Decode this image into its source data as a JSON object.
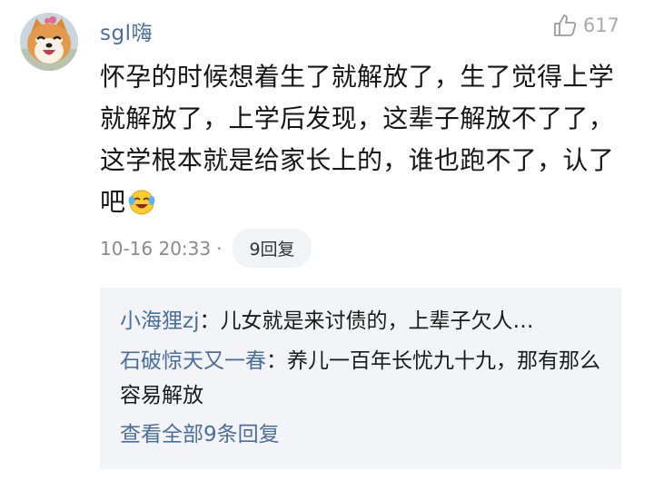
{
  "comment": {
    "username": "sgl嗨",
    "like_count": "617",
    "text": "怀孕的时候想着生了就解放了，生了觉得上学就解放了，上学后发现，这辈子解放不了了，这学根本就是给家长上的，谁也跑不了，认了吧",
    "emoji": "laughing-crying-emoji",
    "time": "10-16 20:33",
    "separator": "·",
    "reply_button_label": "9回复"
  },
  "replies": [
    {
      "author": "小海狸zj",
      "separator": "：",
      "text": "儿女就是来讨债的，上辈子欠人…"
    },
    {
      "author": "石破惊天又一春",
      "separator": "：",
      "text": "养儿一百年长忧九十九，那有那么容易解放"
    }
  ],
  "view_all_label": "查看全部9条回复",
  "colors": {
    "link_blue": "#4a6f9e",
    "reply_box_bg": "#f3f4f7",
    "muted_gray": "#8a8a8a"
  }
}
